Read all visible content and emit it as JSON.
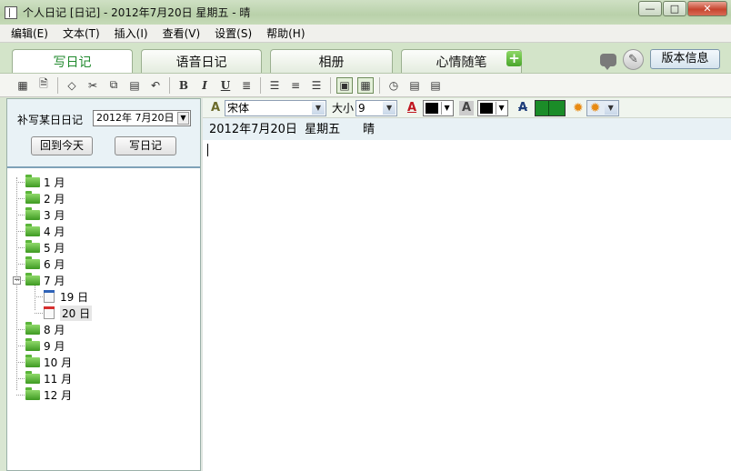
{
  "window": {
    "title": "个人日记  [日记] - 2012年7月20日 星期五 - 晴",
    "min_label": "—",
    "max_label": "□",
    "close_label": "✕"
  },
  "menu": [
    "编辑(E)",
    "文本(T)",
    "插入(I)",
    "查看(V)",
    "设置(S)",
    "帮助(H)"
  ],
  "tabs": [
    {
      "label": "写日记",
      "active": true
    },
    {
      "label": "语音日记",
      "active": false
    },
    {
      "label": "相册",
      "active": false
    },
    {
      "label": "心情随笔",
      "active": false
    }
  ],
  "header_buttons": {
    "add": "+",
    "version": "版本信息"
  },
  "format": {
    "font_name": "宋体",
    "size_label": "大小",
    "size_value": "9"
  },
  "left": {
    "date_label": "补写某日日记",
    "date_value": "2012年 7月20日",
    "today_button": "回到今天",
    "write_button": "写日记"
  },
  "tree": {
    "months": [
      "1 月",
      "2 月",
      "3 月",
      "4 月",
      "5 月",
      "6 月",
      "7 月",
      "8 月",
      "9 月",
      "10 月",
      "11 月",
      "12 月"
    ],
    "july_days": [
      "19 日",
      "20 日"
    ],
    "expanded_month": "7 月",
    "selected_day": "20 日"
  },
  "editor": {
    "header": "2012年7月20日  星期五      晴"
  },
  "colors": {
    "tab_active_text": "#218a2e",
    "text_color": "#000000",
    "highlight_color": "#1b8c28"
  }
}
